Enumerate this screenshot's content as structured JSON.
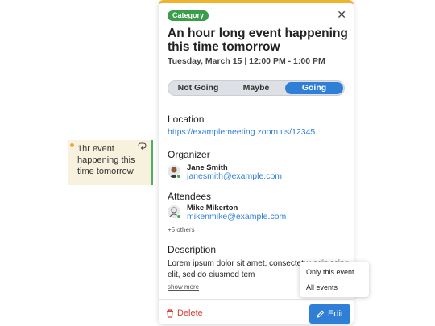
{
  "chip": {
    "text": "1hr event happening this time tomorrow"
  },
  "card": {
    "category": "Category",
    "title": "An hour long event happening this time tomorrow",
    "datetime": "Tuesday, March 15 | 12:00 PM - 1:00 PM",
    "rsvp": [
      "Not Going",
      "Maybe",
      "Going"
    ],
    "rsvp_selected": "Going",
    "location_label": "Location",
    "location_url": "https://examplemeeting.zoom.us/12345",
    "organizer_label": "Organizer",
    "organizer": {
      "name": "Jane Smith",
      "email": "janesmith@example.com"
    },
    "attendees_label": "Attendees",
    "attendee": {
      "name": "Mike Mikerton",
      "email": "mikenmike@example.com"
    },
    "others": "+5 others",
    "description_label": "Description",
    "description": "Lorem ipsum dolor sit amet, consectetur adipiscing elit, sed do eiusmod tem",
    "show_more": "show more",
    "delete_label": "Delete",
    "edit_label": "Edit"
  },
  "edit_menu": {
    "items": [
      "Only this event",
      "All events"
    ]
  },
  "colors": {
    "accent": "#2f7fd6",
    "category": "#3a9d4b",
    "top_border": "#f0b32d",
    "delete": "#d6443a"
  }
}
